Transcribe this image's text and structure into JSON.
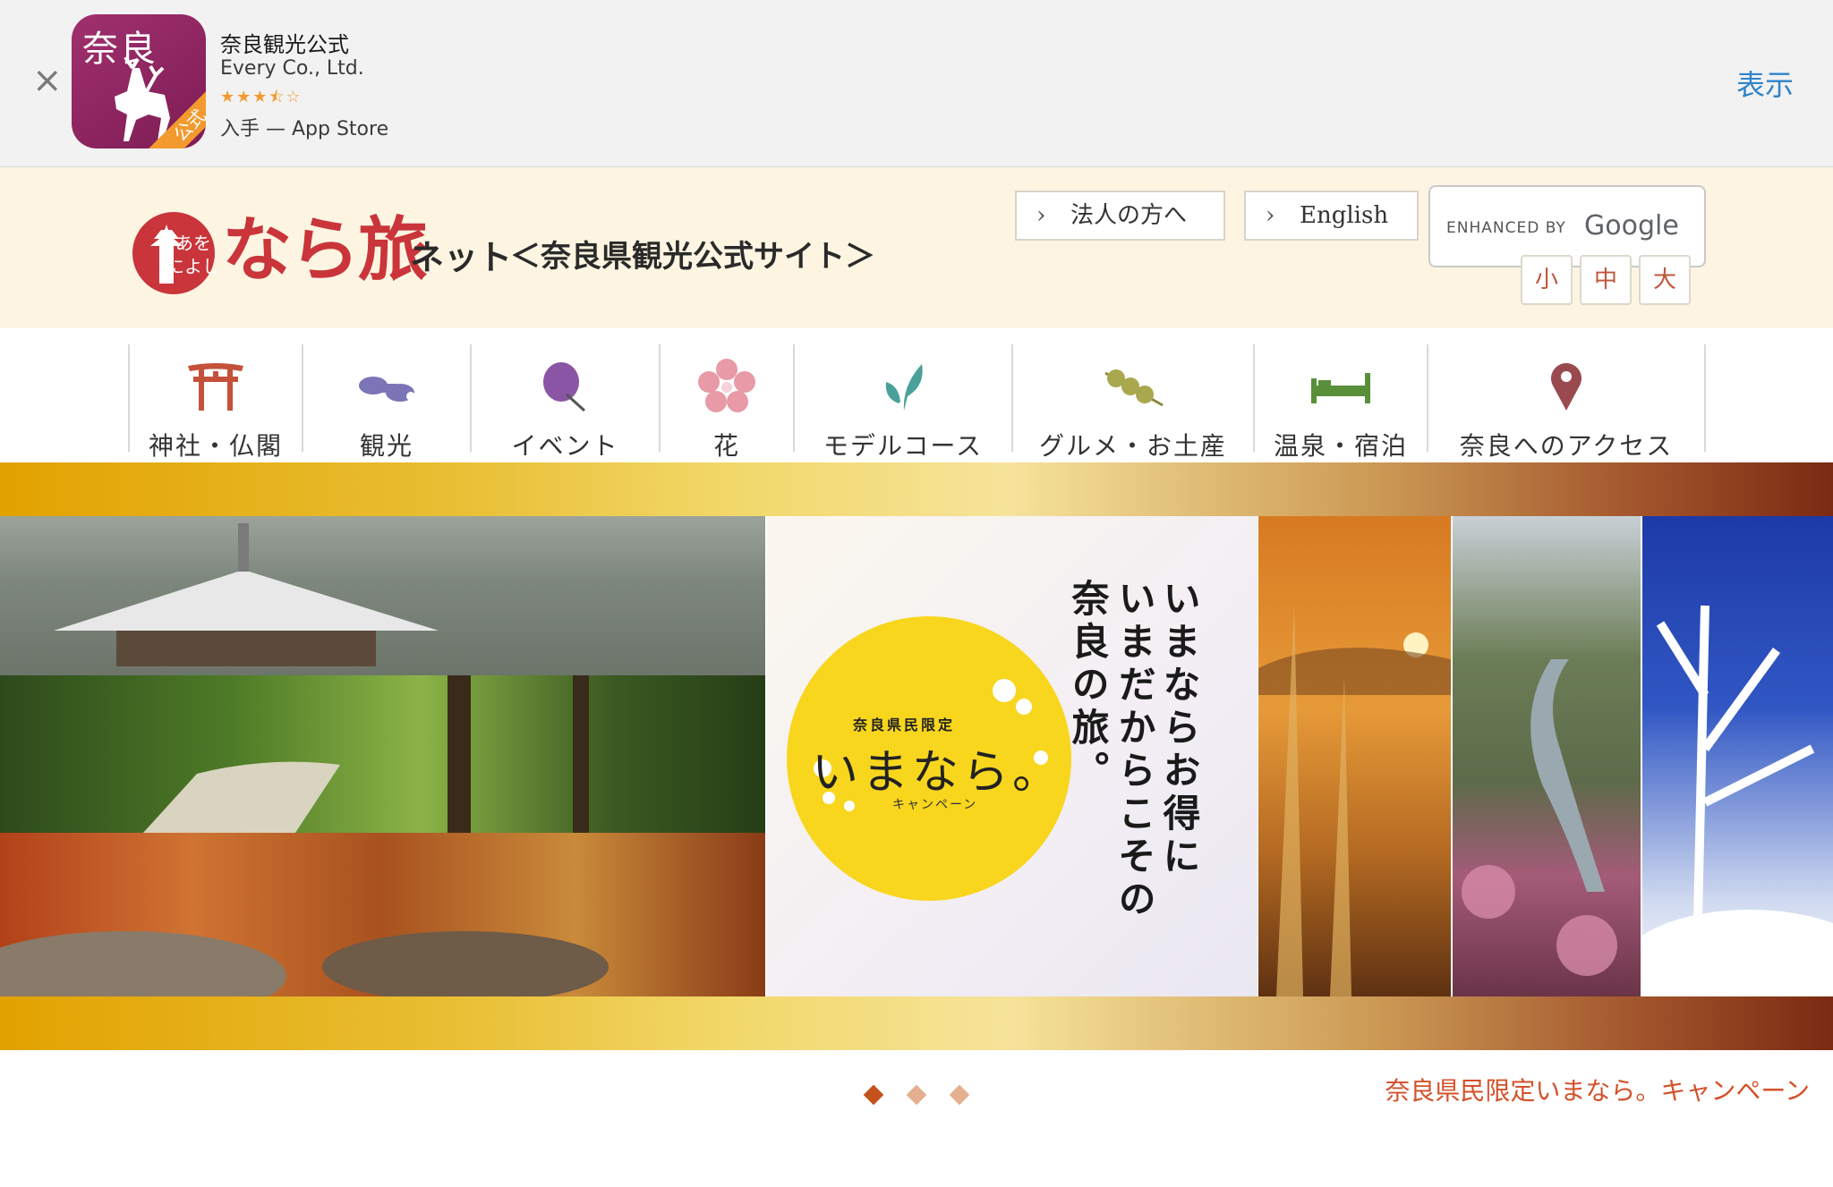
{
  "app_banner": {
    "close_glyph": "×",
    "icon_text": "奈良",
    "icon_ribbon": "公式",
    "name": "奈良観光公式",
    "company": "Every Co., Ltd.",
    "rating": 3.5,
    "stars_glyph": "★★★⯪☆",
    "store_line": "入手 — App Store",
    "view_label": "表示"
  },
  "header": {
    "logo_seal_text": "あをによし",
    "logo_main": "なら旅",
    "logo_suffix": "ネット",
    "subtitle": "＜奈良県観光公式サイト＞",
    "buttons": [
      {
        "label": "法人の方へ"
      },
      {
        "label": "English"
      }
    ],
    "search": {
      "enhanced_by": "ENHANCED BY",
      "google": "Google"
    },
    "font_size": {
      "small": "小",
      "medium": "中",
      "large": "大"
    }
  },
  "nav": {
    "items": [
      {
        "label": "神社・仏閣",
        "icon": "torii-icon"
      },
      {
        "label": "観光",
        "icon": "binoculars-icon"
      },
      {
        "label": "イベント",
        "icon": "fan-icon"
      },
      {
        "label": "花",
        "icon": "flower-icon"
      },
      {
        "label": "モデルコース",
        "icon": "leaf-icon"
      },
      {
        "label": "グルメ・お土産",
        "icon": "dango-icon"
      },
      {
        "label": "温泉・宿泊",
        "icon": "bed-icon"
      },
      {
        "label": "奈良へのアクセス",
        "icon": "map-pin-icon"
      }
    ]
  },
  "hero": {
    "promo_top": "奈良県民限定",
    "promo_title": "いまなら。",
    "promo_campaign": "キャンペーン",
    "vertical_lines": [
      "いまならお得に",
      "いまだからこその",
      "奈良の旅。"
    ]
  },
  "carousel": {
    "slide_count": 3,
    "active_index": 0,
    "caption": "奈良県民限定いまなら。キャンペーン"
  },
  "colors": {
    "accent_red": "#c9353a",
    "link_blue": "#2f84c9",
    "caption_orange": "#d4502a",
    "header_bg": "#fdf5e2"
  }
}
